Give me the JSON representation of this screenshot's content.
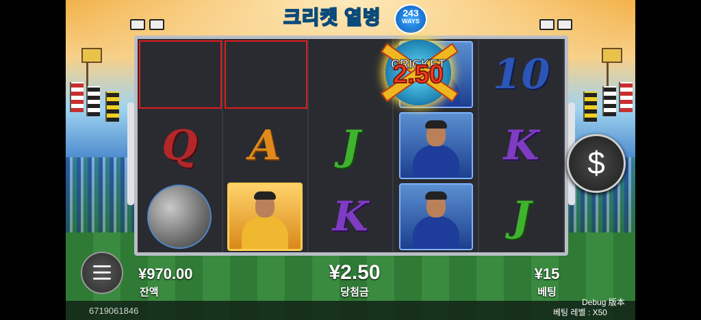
{
  "header": {
    "logo_text": "크리켓 열병",
    "logo_badge_number": "243",
    "logo_badge_word": "WAYS"
  },
  "reels": {
    "rows": [
      [
        {
          "type": "empty",
          "win": true
        },
        {
          "type": "empty",
          "win": true
        },
        {
          "type": "bonus",
          "label": "CRICKET",
          "value": "2.50"
        },
        {
          "type": "portrait",
          "variant": "blue"
        },
        {
          "type": "letter",
          "value": "10",
          "color": "blue"
        }
      ],
      [
        {
          "type": "letter",
          "value": "Q",
          "color": "red"
        },
        {
          "type": "letter",
          "value": "A",
          "color": "orange"
        },
        {
          "type": "letter",
          "value": "J",
          "color": "green"
        },
        {
          "type": "portrait",
          "variant": "blue"
        },
        {
          "type": "letter",
          "value": "K",
          "color": "purple"
        }
      ],
      [
        {
          "type": "ball"
        },
        {
          "type": "portrait",
          "variant": "gold"
        },
        {
          "type": "letter",
          "value": "K",
          "color": "purple"
        },
        {
          "type": "portrait",
          "variant": "blue"
        },
        {
          "type": "letter",
          "value": "J",
          "color": "green"
        }
      ]
    ]
  },
  "win_badge": {
    "word": "CRICKET",
    "value": "2.50"
  },
  "controls": {
    "spin_symbol": "$"
  },
  "stats": {
    "balance_value": "¥970.00",
    "balance_label": "잔액",
    "win_value": "¥2.50",
    "win_label": "당첨금",
    "bet_value": "¥15",
    "bet_label": "베팅"
  },
  "footer": {
    "session_id": "6719061846",
    "debug_label": "Debug 版本",
    "bet_level": "베팅 레벨 : X50"
  },
  "colors": {
    "win_outline": "#e21d1d",
    "frame": "#b9bec6"
  }
}
